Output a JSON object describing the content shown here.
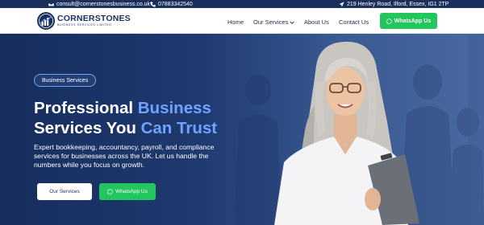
{
  "topbar": {
    "email": "consult@cornerstonesbusiness.co.uk",
    "phone": "07883342540",
    "address": "219 Henley Road, Ilford, Essex, IG1 2TP"
  },
  "brand": {
    "name": "CORNERSTONES",
    "tagline": "BUSINESS SERVICES LIMITED"
  },
  "nav": {
    "items": [
      "Home",
      "Our Services",
      "About Us",
      "Contact Us"
    ],
    "whatsapp_label": "WhatsApp Us"
  },
  "hero": {
    "badge": "Business Services",
    "headline_part1": "Professional ",
    "headline_accent1": "Business",
    "headline_part2": "Services You ",
    "headline_accent2": "Can Trust",
    "subtext": "Expert bookkeeping, accountancy, payroll, and compliance services for businesses across the UK. Let us handle the numbers while you focus on growth.",
    "primary_button": "Our Services",
    "whatsapp_button": "WhatsApp Us"
  },
  "colors": {
    "navy": "#1a2f5c",
    "accent_blue": "#6ea4ff",
    "whatsapp_green": "#22c55e"
  }
}
